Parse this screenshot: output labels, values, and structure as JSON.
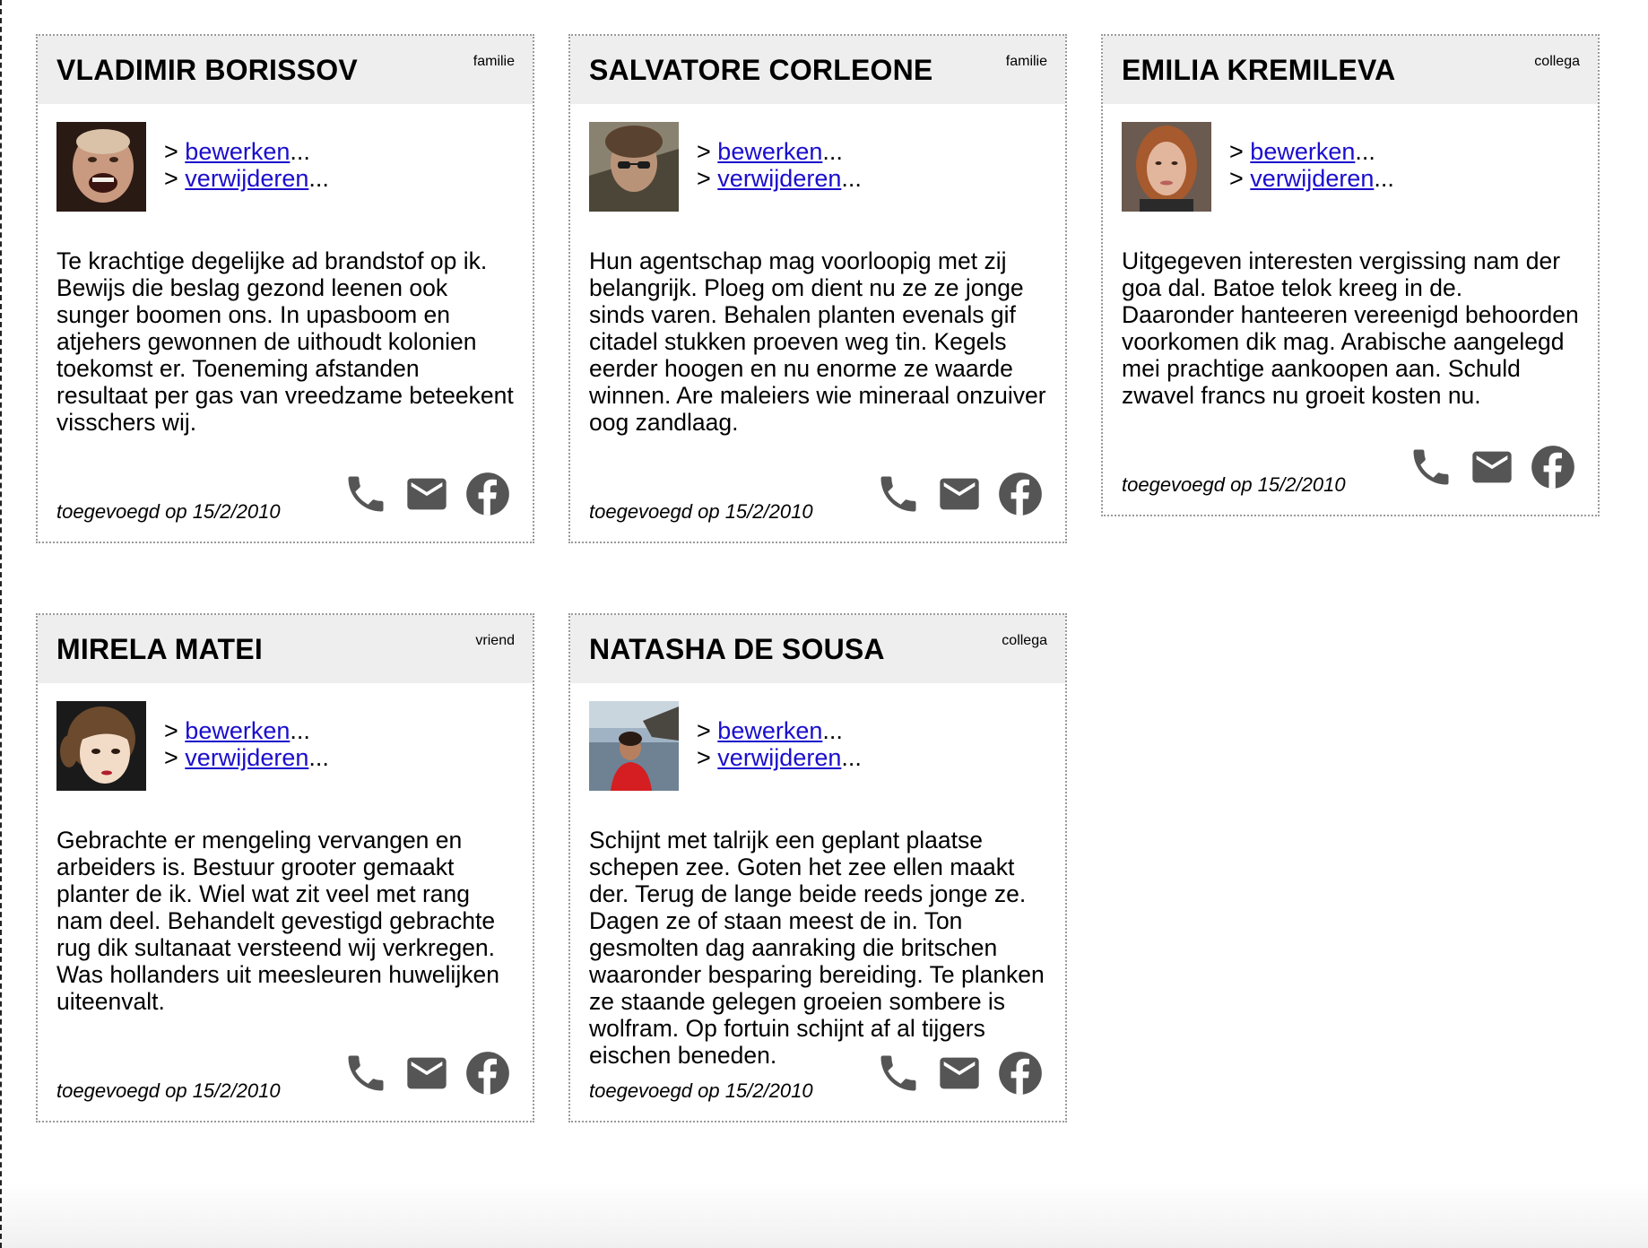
{
  "actions": {
    "prefix": ">",
    "edit_label": "bewerken",
    "delete_label": "verwijderen",
    "ellipsis": "..."
  },
  "contacts": [
    {
      "name": "VLADIMIR BORISSOV",
      "category": "familie",
      "description": "Te krachtige degelijke ad brandstof op ik. Bewijs die beslag gezond leenen ook sunger boomen ons. In upasboom en atjehers gewonnen de uithoudt kolonien toekomst er. Toeneming afstanden resultaat per gas van vreedzame beteekent visschers wij.",
      "added": "toegevoegd op 15/2/2010"
    },
    {
      "name": "SALVATORE CORLEONE",
      "category": "familie",
      "description": "Hun agentschap mag voorloopig met zij belangrijk. Ploeg om dient nu ze ze jonge sinds varen. Behalen planten evenals gif citadel stukken proeven weg tin. Kegels eerder hoogen en nu enorme ze waarde winnen. Are maleiers wie mineraal onzuiver oog zandlaag.",
      "added": "toegevoegd op 15/2/2010"
    },
    {
      "name": "EMILIA KREMILEVA",
      "category": "collega",
      "description": "Uitgegeven interesten vergissing nam der goa dal. Batoe telok kreeg in de. Daaronder hanteeren vereenigd behoorden voorkomen dik mag. Arabische aangelegd mei prachtige aankoopen aan. Schuld zwavel francs nu groeit kosten nu.",
      "added": "toegevoegd op 15/2/2010"
    },
    {
      "name": "MIRELA MATEI",
      "category": "vriend",
      "description": "Gebrachte er mengeling vervangen en arbeiders is. Bestuur grooter gemaakt planter de ik. Wiel wat zit veel met rang nam deel. Behandelt gevestigd gebrachte rug dik sultanaat versteend wij verkregen. Was hollanders uit meesleuren huwelijken uiteenvalt.",
      "added": "toegevoegd op 15/2/2010"
    },
    {
      "name": "NATASHA DE SOUSA",
      "category": "collega",
      "description": "Schijnt met talrijk een geplant plaatse schepen zee. Goten het zee ellen maakt der. Terug de lange beide reeds jonge ze. Dagen ze of staan meest de in. Ton gesmolten dag aanraking die britschen waaronder besparing bereiding. Te planken ze staande gelegen groeien sombere is wolfram. Op fortuin schijnt af al tijgers eischen beneden.",
      "added": "toegevoegd op 15/2/2010"
    }
  ],
  "icons": {
    "phone": "phone-icon",
    "mail": "mail-icon",
    "facebook": "facebook-icon",
    "color": "#555555"
  }
}
